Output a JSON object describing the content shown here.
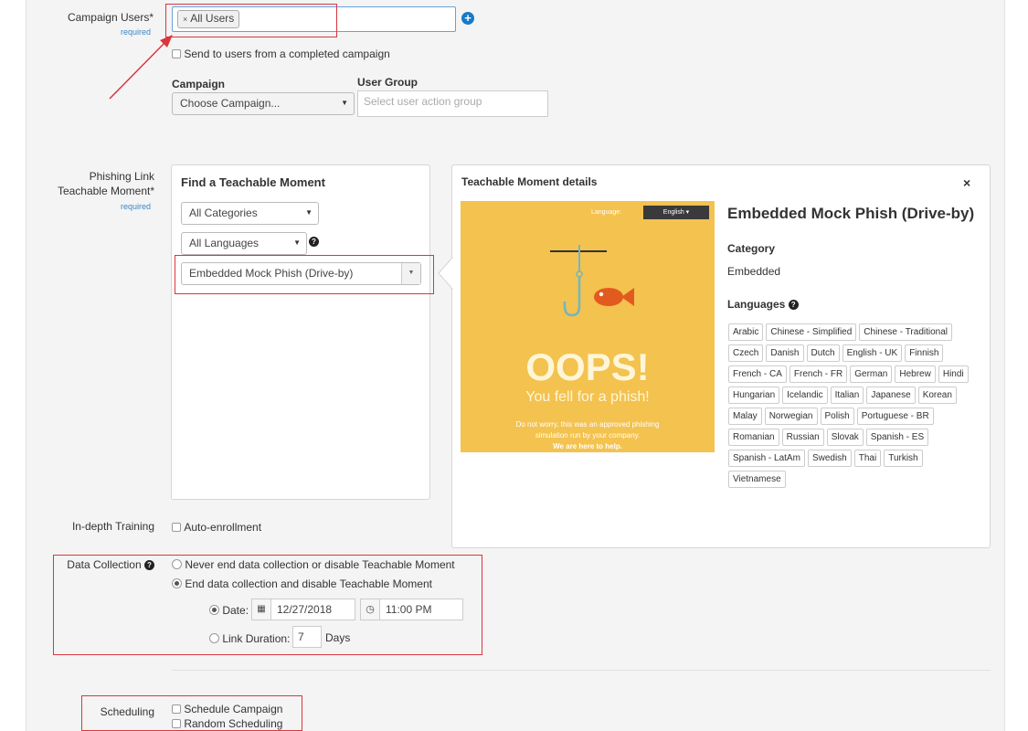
{
  "campaign_users": {
    "label": "Campaign Users*",
    "required": "required",
    "token": "All Users",
    "send_completed_label": "Send to users from a completed campaign",
    "campaign_label": "Campaign",
    "campaign_placeholder": "Choose Campaign...",
    "user_group_label": "User Group",
    "user_group_placeholder": "Select user action group"
  },
  "phishing": {
    "label_line1": "Phishing Link",
    "label_line2": "Teachable Moment*",
    "required": "required",
    "find_title": "Find a Teachable Moment",
    "categories_value": "All Categories",
    "languages_value": "All Languages",
    "moment_value": "Embedded Mock Phish (Drive-by)"
  },
  "details": {
    "title": "Teachable Moment details",
    "preview": {
      "language_label": "Language:",
      "language_value": "English ▾",
      "headline": "OOPS!",
      "subheadline": "You fell for a phish!",
      "body_line1": "Do not worry, this was an approved phishing",
      "body_line2": "simulation run by your company.",
      "body_line3": "We are here to help."
    },
    "name": "Embedded Mock Phish (Drive-by)",
    "category_heading": "Category",
    "category_value": "Embedded",
    "languages_heading": "Languages",
    "languages": [
      "Arabic",
      "Chinese - Simplified",
      "Chinese - Traditional",
      "Czech",
      "Danish",
      "Dutch",
      "English - UK",
      "Finnish",
      "French - CA",
      "French - FR",
      "German",
      "Hebrew",
      "Hindi",
      "Hungarian",
      "Icelandic",
      "Italian",
      "Japanese",
      "Korean",
      "Malay",
      "Norwegian",
      "Polish",
      "Portuguese - BR",
      "Romanian",
      "Russian",
      "Slovak",
      "Spanish - ES",
      "Spanish - LatAm",
      "Swedish",
      "Thai",
      "Turkish",
      "Vietnamese"
    ]
  },
  "training": {
    "label": "In-depth Training",
    "auto_enroll": "Auto-enrollment"
  },
  "data_collection": {
    "label": "Data Collection",
    "never_end": "Never end data collection or disable Teachable Moment",
    "end": "End data collection and disable Teachable Moment",
    "date_label": "Date:",
    "date_value": "12/27/2018",
    "time_value": "11:00 PM",
    "duration_label": "Link Duration:",
    "duration_value": "7",
    "days": "Days"
  },
  "scheduling": {
    "label": "Scheduling",
    "schedule": "Schedule Campaign",
    "random": "Random Scheduling"
  },
  "colors": {
    "accent": "#1a79c7",
    "annotation_red": "#d9363e",
    "preview_bg": "#f3c24f"
  }
}
